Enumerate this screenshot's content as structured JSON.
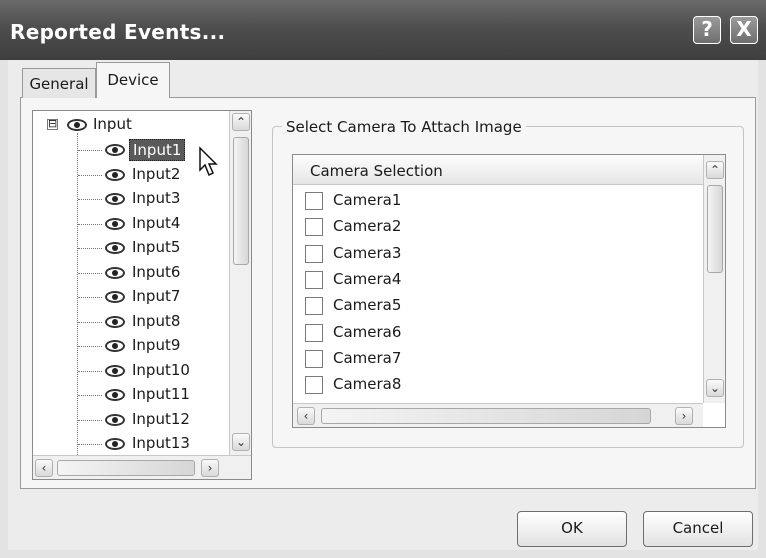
{
  "window": {
    "title": "Reported Events...",
    "help_glyph": "?",
    "close_glyph": "X"
  },
  "tabs": [
    {
      "label": "General",
      "active": false
    },
    {
      "label": "Device",
      "active": true
    }
  ],
  "tree": {
    "root_label": "Input",
    "root_expander": "⊟",
    "selected": "Input1",
    "items": [
      "Input1",
      "Input2",
      "Input3",
      "Input4",
      "Input5",
      "Input6",
      "Input7",
      "Input8",
      "Input9",
      "Input10",
      "Input11",
      "Input12",
      "Input13"
    ]
  },
  "camera_group": {
    "label": "Select Camera To Attach Image",
    "column_header": "Camera Selection",
    "cameras": [
      {
        "label": "Camera1",
        "checked": false
      },
      {
        "label": "Camera2",
        "checked": false
      },
      {
        "label": "Camera3",
        "checked": false
      },
      {
        "label": "Camera4",
        "checked": false
      },
      {
        "label": "Camera5",
        "checked": false
      },
      {
        "label": "Camera6",
        "checked": false
      },
      {
        "label": "Camera7",
        "checked": false
      },
      {
        "label": "Camera8",
        "checked": false
      }
    ]
  },
  "buttons": {
    "ok": "OK",
    "cancel": "Cancel"
  },
  "colors": {
    "title_bar": "#4e4e4e",
    "selection": "#5a5a5a",
    "dialog_bg": "#f6f6f6"
  }
}
